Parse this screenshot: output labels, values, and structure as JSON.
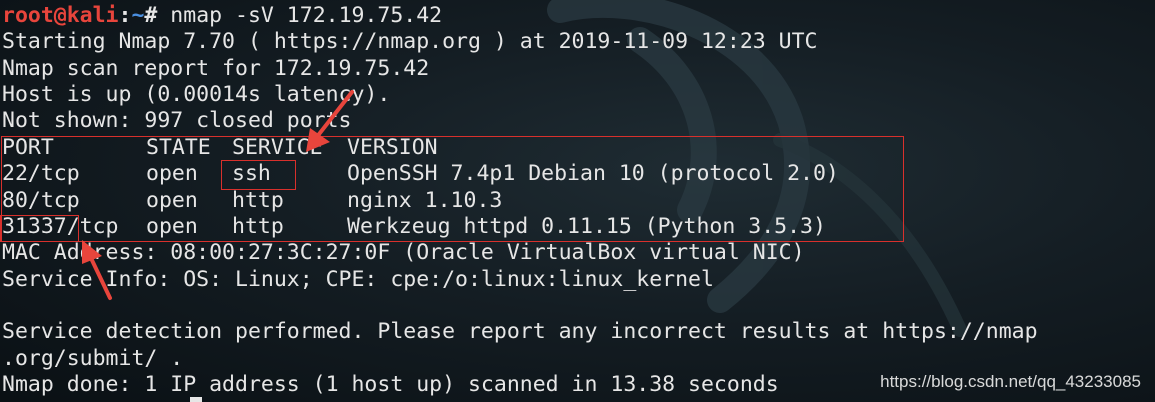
{
  "prompt": {
    "user_host": "root@kali",
    "separator": ":",
    "path": "~",
    "symbol": "#",
    "command": " nmap -sV 172.19.75.42"
  },
  "output": {
    "starting": "Starting Nmap 7.70 ( https://nmap.org ) at 2019-11-09 12:23 UTC",
    "report": "Nmap scan report for 172.19.75.42",
    "host_up": "Host is up (0.00014s latency).",
    "not_shown": "Not shown: 997 closed ports",
    "table": {
      "headers": [
        "PORT",
        "STATE",
        "SERVICE",
        "VERSION"
      ],
      "rows": [
        [
          "22/tcp",
          "open",
          "ssh",
          "OpenSSH 7.4p1 Debian 10 (protocol 2.0)"
        ],
        [
          "80/tcp",
          "open",
          "http",
          "nginx 1.10.3"
        ],
        [
          "31337/tcp",
          "open",
          "http",
          "Werkzeug httpd 0.11.15 (Python 3.5.3)"
        ]
      ]
    },
    "mac": "MAC Address: 08:00:27:3C:27:0F (Oracle VirtualBox virtual NIC)",
    "service_info": "Service Info: OS: Linux; CPE: cpe:/o:linux:linux_kernel",
    "detection_1": "Service detection performed. Please report any incorrect results at https://nmap",
    "detection_2": ".org/submit/ .",
    "done": "Nmap done: 1 IP address (1 host up) scanned in 13.38 seconds"
  },
  "watermark": "https://blog.csdn.net/qq_43233085",
  "colors": {
    "background": "#141d23",
    "text": "#e6e6e6",
    "prompt_user": "#e8453c",
    "prompt_path": "#4a8fe0",
    "annotation": "#d8302c"
  }
}
